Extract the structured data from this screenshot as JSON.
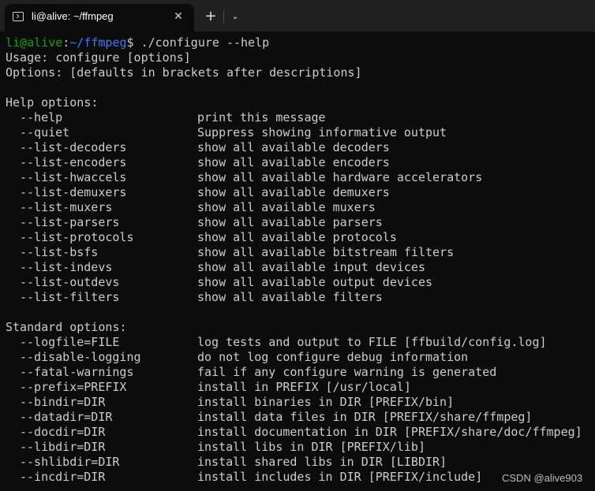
{
  "tab": {
    "title": "li@alive: ~/ffmpeg",
    "icon": "terminal-icon",
    "close_glyph": "✕"
  },
  "toolbar": {
    "new_tab_glyph": "+",
    "dropdown_glyph": "⌄"
  },
  "colors": {
    "background": "#0c0c0c",
    "text": "#cccccc",
    "user": "#13a10e",
    "path": "#3b78ff"
  },
  "prompt": {
    "user_host": "li@alive",
    "sep": ":",
    "path": "~/ffmpeg",
    "symbol": "$",
    "command": " ./configure --help"
  },
  "usage_line": "Usage: configure [options]",
  "options_line": "Options: [defaults in brackets after descriptions]",
  "help_header": "Help options:",
  "help_options": [
    {
      "opt": "--help",
      "desc": "print this message"
    },
    {
      "opt": "--quiet",
      "desc": "Suppress showing informative output"
    },
    {
      "opt": "--list-decoders",
      "desc": "show all available decoders"
    },
    {
      "opt": "--list-encoders",
      "desc": "show all available encoders"
    },
    {
      "opt": "--list-hwaccels",
      "desc": "show all available hardware accelerators"
    },
    {
      "opt": "--list-demuxers",
      "desc": "show all available demuxers"
    },
    {
      "opt": "--list-muxers",
      "desc": "show all available muxers"
    },
    {
      "opt": "--list-parsers",
      "desc": "show all available parsers"
    },
    {
      "opt": "--list-protocols",
      "desc": "show all available protocols"
    },
    {
      "opt": "--list-bsfs",
      "desc": "show all available bitstream filters"
    },
    {
      "opt": "--list-indevs",
      "desc": "show all available input devices"
    },
    {
      "opt": "--list-outdevs",
      "desc": "show all available output devices"
    },
    {
      "opt": "--list-filters",
      "desc": "show all available filters"
    }
  ],
  "standard_header": "Standard options:",
  "standard_options": [
    {
      "opt": "--logfile=FILE",
      "desc": "log tests and output to FILE [ffbuild/config.log]"
    },
    {
      "opt": "--disable-logging",
      "desc": "do not log configure debug information"
    },
    {
      "opt": "--fatal-warnings",
      "desc": "fail if any configure warning is generated"
    },
    {
      "opt": "--prefix=PREFIX",
      "desc": "install in PREFIX [/usr/local]"
    },
    {
      "opt": "--bindir=DIR",
      "desc": "install binaries in DIR [PREFIX/bin]"
    },
    {
      "opt": "--datadir=DIR",
      "desc": "install data files in DIR [PREFIX/share/ffmpeg]"
    },
    {
      "opt": "--docdir=DIR",
      "desc": "install documentation in DIR [PREFIX/share/doc/ffmpeg]"
    },
    {
      "opt": "--libdir=DIR",
      "desc": "install libs in DIR [PREFIX/lib]"
    },
    {
      "opt": "--shlibdir=DIR",
      "desc": "install shared libs in DIR [LIBDIR]"
    },
    {
      "opt": "--incdir=DIR",
      "desc": "install includes in DIR [PREFIX/include]"
    }
  ],
  "watermark": "CSDN @alive903"
}
